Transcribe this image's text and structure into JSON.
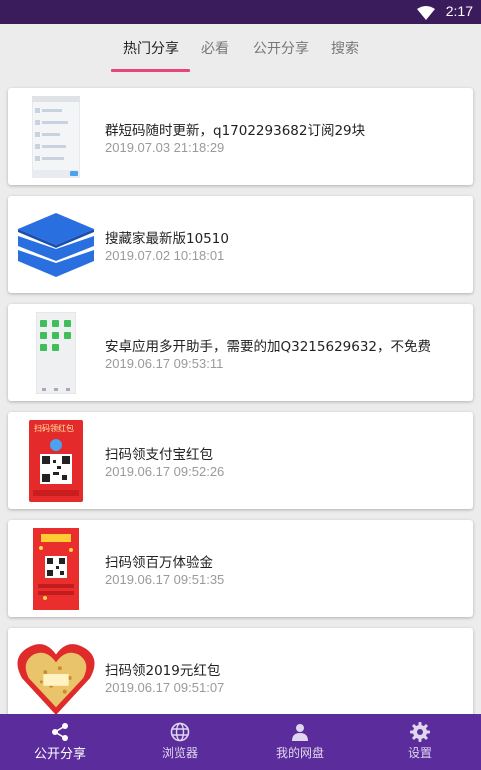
{
  "status_bar": {
    "time": "2:17",
    "icons": [
      "wifi-icon"
    ]
  },
  "tabs": [
    {
      "label": "热门分享",
      "active": true
    },
    {
      "label": "必看",
      "active": false
    },
    {
      "label": "公开分享",
      "active": false
    },
    {
      "label": "搜索",
      "active": false
    }
  ],
  "items": [
    {
      "title": "群短码随时更新，q1702293682订阅29块",
      "time": "2019.07.03 21:18:29",
      "thumb": "chat-screenshot-thumbnail"
    },
    {
      "title": "搜藏家最新版10510",
      "time": "2019.07.02 10:18:01",
      "thumb": "layers-app-icon"
    },
    {
      "title": "安卓应用多开助手，需要的加Q3215629632，不免费",
      "time": "2019.06.17 09:53:11",
      "thumb": "app-grid-screenshot-thumbnail"
    },
    {
      "title": "扫码领支付宝红包",
      "time": "2019.06.17 09:52:26",
      "thumb": "red-packet-qr-poster"
    },
    {
      "title": "扫码领百万体验金",
      "time": "2019.06.17 09:51:35",
      "thumb": "red-qr-poster"
    },
    {
      "title": "扫码领2019元红包",
      "time": "2019.06.17 09:51:07",
      "thumb": "heart-red-packet-image"
    }
  ],
  "thumb_text": {
    "alipay_banner": "扫码领红包"
  },
  "bottom_nav": [
    {
      "label": "公开分享",
      "icon": "share-icon",
      "active": true
    },
    {
      "label": "浏览器",
      "icon": "globe-icon",
      "active": false
    },
    {
      "label": "我的网盘",
      "icon": "person-icon",
      "active": false
    },
    {
      "label": "设置",
      "icon": "gear-icon",
      "active": false
    }
  ],
  "colors": {
    "status_bar": "#3a1b5c",
    "bottom_nav": "#5b2d9c",
    "tab_indicator": "#e8457d",
    "app_icon_blue": "#2a6fe0"
  }
}
